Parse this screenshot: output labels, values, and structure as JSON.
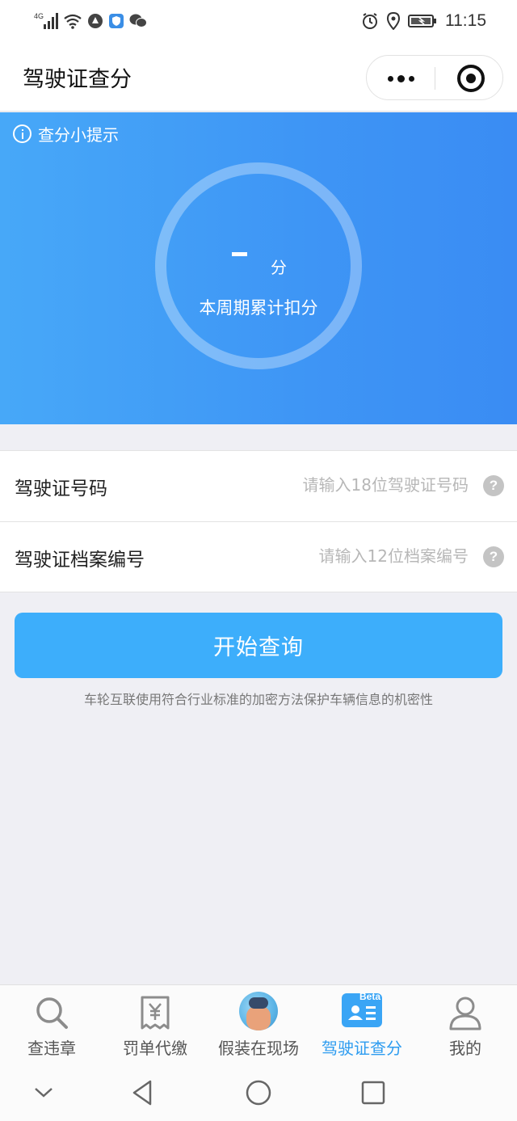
{
  "status_bar": {
    "network": "4G",
    "time": "11:15"
  },
  "header": {
    "title": "驾驶证查分"
  },
  "hero": {
    "tips_label": "查分小提示",
    "score": "-",
    "score_unit": "分",
    "caption": "本周期累计扣分"
  },
  "form": {
    "fields": [
      {
        "label": "驾驶证号码",
        "value": "",
        "placeholder": "请输入18位驾驶证号码"
      },
      {
        "label": "驾驶证档案编号",
        "value": "",
        "placeholder": "请输入12位档案编号"
      }
    ],
    "help_glyph": "?"
  },
  "query_button": "开始查询",
  "privacy_note": "车轮互联使用符合行业标准的加密方法保护车辆信息的机密性",
  "tab_bar": {
    "items": [
      {
        "label": "查违章",
        "icon": "search-icon",
        "active": false
      },
      {
        "label": "罚单代缴",
        "icon": "receipt-icon",
        "active": false
      },
      {
        "label": "假装在现场",
        "icon": "avatar-icon",
        "active": false
      },
      {
        "label": "驾驶证查分",
        "icon": "license-card-icon",
        "badge": "Beta",
        "active": true
      },
      {
        "label": "我的",
        "icon": "user-icon",
        "active": false
      }
    ]
  },
  "colors": {
    "accent": "#3daefb",
    "hero_start": "#47a8f8",
    "hero_end": "#3a8cf3",
    "active_tab": "#2d9cf0"
  }
}
